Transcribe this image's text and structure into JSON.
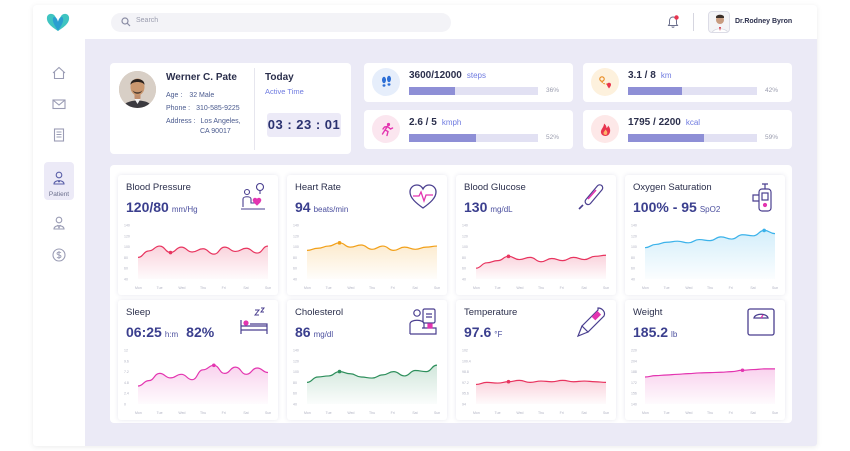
{
  "topbar": {
    "search_placeholder": "Search",
    "doctor_name": "Dr.Rodney Byron",
    "notification_dot_color": "#e8344f"
  },
  "sidebar": {
    "items": [
      {
        "icon": "home-icon"
      },
      {
        "icon": "mail-icon"
      },
      {
        "icon": "document-icon"
      },
      {
        "icon": "patient-icon",
        "label": "Patient",
        "active": true
      },
      {
        "icon": "doctor-icon"
      },
      {
        "icon": "dollar-icon"
      }
    ]
  },
  "patient": {
    "name": "Werner C. Pate",
    "age_label": "Age :",
    "age_value": "32 Male",
    "phone_label": "Phone :",
    "phone_value": "310-585-9225",
    "address_label": "Address :",
    "address_line1": "Los Angeles,",
    "address_line2": "CA 90017",
    "today_label": "Today",
    "active_time_label": "Active Time",
    "active_time": "03 : 23 : 01"
  },
  "metrics": [
    {
      "id": "steps",
      "value": "3600/12000",
      "unit": "steps",
      "percent_label": "36%",
      "fraction": 0.36,
      "icon": "footsteps-icon",
      "bg": "#e6eefb"
    },
    {
      "id": "distance",
      "value": "3.1 / 8",
      "unit": "km",
      "percent_label": "42%",
      "fraction": 0.42,
      "icon": "route-icon",
      "bg": "#fdf1dd"
    },
    {
      "id": "speed",
      "value": "2.6 / 5",
      "unit": "kmph",
      "percent_label": "52%",
      "fraction": 0.52,
      "icon": "running-icon",
      "bg": "#fbe6ef"
    },
    {
      "id": "calories",
      "value": "1795 / 2200",
      "unit": "kcal",
      "percent_label": "59%",
      "fraction": 0.59,
      "icon": "flame-icon",
      "bg": "#fde8e8"
    }
  ],
  "vitals": [
    {
      "title": "Blood Pressure",
      "value": "120/80",
      "unit": "mm/Hg",
      "icon": "blood-pressure-icon",
      "color": "#e8345f"
    },
    {
      "title": "Heart Rate",
      "value": "94",
      "unit": "beats/min",
      "icon": "heartbeat-icon",
      "color": "#f2a019"
    },
    {
      "title": "Blood Glucose",
      "value": "130",
      "unit": "mg/dL",
      "icon": "thermometer-icon",
      "color": "#e8345f"
    },
    {
      "title": "Oxygen Saturation",
      "value": "100% - 95",
      "unit": "SpO2",
      "icon": "oximeter-icon",
      "color": "#3bb2ea"
    },
    {
      "title": "Sleep",
      "value": "06:25",
      "unit": "h:m",
      "value2": "82%",
      "icon": "bed-icon",
      "color": "#e335b0"
    },
    {
      "title": "Cholesterol",
      "value": "86",
      "unit": "mg/dl",
      "icon": "lab-test-icon",
      "color": "#2e8f5c"
    },
    {
      "title": "Temperature",
      "value": "97.6",
      "unit": "°F",
      "icon": "digital-thermometer-icon",
      "color": "#e8345f"
    },
    {
      "title": "Weight",
      "value": "185.2",
      "unit": "lb",
      "icon": "scale-icon",
      "color": "#e335b0"
    }
  ],
  "chart_data": [
    {
      "type": "line",
      "title": "Blood Pressure",
      "x": [
        "Mon",
        "Tue",
        "Wed",
        "Thu",
        "Fri",
        "Sat",
        "Sun"
      ],
      "ylim": [
        40,
        140
      ],
      "values": [
        80,
        92,
        101,
        89,
        99,
        90,
        96,
        86,
        99,
        91,
        97,
        88,
        101
      ],
      "highlight_index": 3
    },
    {
      "type": "line",
      "title": "Heart Rate",
      "x": [
        "Mon",
        "Tue",
        "Wed",
        "Thu",
        "Fri",
        "Sat",
        "Sun"
      ],
      "ylim": [
        40,
        140
      ],
      "values": [
        93,
        97,
        101,
        107,
        99,
        103,
        95,
        101,
        93,
        99,
        95,
        99,
        101
      ],
      "highlight_index": 3
    },
    {
      "type": "line",
      "title": "Blood Glucose",
      "x": [
        "Mon",
        "Tue",
        "Wed",
        "Thu",
        "Fri",
        "Sat",
        "Sun"
      ],
      "ylim": [
        40,
        140
      ],
      "values": [
        60,
        70,
        74,
        82,
        76,
        80,
        72,
        78,
        74,
        80,
        76,
        82,
        84
      ],
      "highlight_index": 3
    },
    {
      "type": "line",
      "title": "Oxygen Saturation",
      "x": [
        "Mon",
        "Tue",
        "Wed",
        "Thu",
        "Fri",
        "Sat",
        "Sun"
      ],
      "ylim": [
        40,
        140
      ],
      "values": [
        98,
        104,
        108,
        110,
        107,
        113,
        111,
        118,
        114,
        122,
        120,
        130,
        124
      ],
      "highlight_index": 11
    },
    {
      "type": "line",
      "title": "Sleep",
      "x": [
        "Mon",
        "Tue",
        "Wed",
        "Thu",
        "Fri",
        "Sat",
        "Sun"
      ],
      "ylim": [
        0,
        12
      ],
      "values": [
        4,
        5.2,
        6.8,
        5.8,
        6.6,
        5.4,
        7.6,
        8.6,
        6.8,
        8.2,
        6.6,
        8.0,
        7.0
      ],
      "highlight_index": 7
    },
    {
      "type": "line",
      "title": "Cholesterol",
      "x": [
        "Mon",
        "Tue",
        "Wed",
        "Thu",
        "Fri",
        "Sat",
        "Sun"
      ],
      "ylim": [
        40,
        140
      ],
      "values": [
        80,
        90,
        92,
        100,
        96,
        90,
        88,
        94,
        100,
        92,
        102,
        100,
        112
      ],
      "highlight_index": 3
    },
    {
      "type": "line",
      "title": "Temperature",
      "x": [
        "Mon",
        "Tue",
        "Wed",
        "Thu",
        "Fri",
        "Sat",
        "Sun"
      ],
      "ylim": [
        94,
        102
      ],
      "values": [
        96.9,
        97.2,
        97.1,
        97.3,
        97.5,
        97.2,
        97.4,
        97.3,
        97.5,
        97.3,
        97.4,
        97.3,
        97.2
      ],
      "highlight_index": 3
    },
    {
      "type": "line",
      "title": "Weight",
      "x": [
        "Mon",
        "Tue",
        "Wed",
        "Thu",
        "Fri",
        "Sat",
        "Sun"
      ],
      "ylim": [
        140,
        220
      ],
      "values": [
        180,
        182,
        183,
        184,
        185,
        186,
        186.5,
        187,
        188,
        190,
        191,
        192,
        192
      ],
      "highlight_index": 9
    }
  ]
}
